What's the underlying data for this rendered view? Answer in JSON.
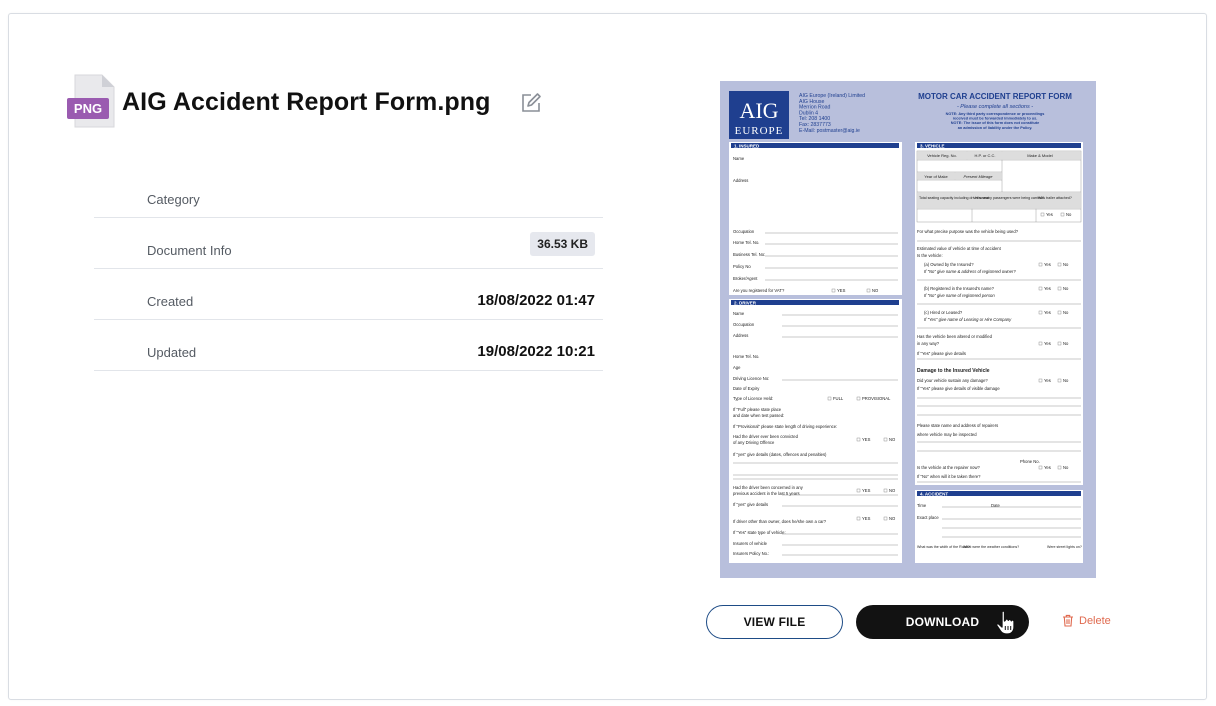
{
  "file": {
    "title": "AIG Accident Report Form.png",
    "type_badge": "PNG"
  },
  "info": [
    {
      "label": "Category",
      "value": ""
    },
    {
      "label": "Document Info",
      "badge": "36.53 KB"
    },
    {
      "label": "Created",
      "value": "18/08/2022 01:47"
    },
    {
      "label": "Updated",
      "value": "19/08/2022 10:21"
    }
  ],
  "preview": {
    "logo_top": "AIG",
    "logo_bottom": "EUROPE",
    "company_lines": [
      "AIG Europe (Ireland) Limited",
      "AIG House",
      "Merrion Road",
      "Dublin 4",
      "Tel: 208 1400",
      "Fax: 2837773",
      "E-Mail: postmaster@aig.ie"
    ],
    "form_title": "MOTOR CAR ACCIDENT REPORT FORM",
    "form_subtitle": "- Please complete all sections -",
    "notes": [
      "NOTE: Any third party correspondence or proceedings",
      "received must be forwarded immediately to us.",
      "NOTE: The issue of this form does not constitute",
      "an admission of liability under the Policy."
    ],
    "sections": {
      "insured": "1. INSURED",
      "driver": "2. DRIVER",
      "vehicle": "3. VEHICLE",
      "accident": "4. ACCIDENT",
      "damage": "Damage to the Insured Vehicle"
    },
    "insured_fields": [
      "Name",
      "Address",
      "Occupation",
      "Home Tel. No.",
      "Business Tel. No:",
      "Policy No",
      "Broker/Agent",
      "Are you registered for VAT?"
    ],
    "driver_fields": [
      "Name",
      "Occupation",
      "Address",
      "Home Tel. No.",
      "Age",
      "Driving Licence No:",
      "Date of Expiry",
      "Type of Licence Held:",
      "If \"Full\" please state place",
      "and date when test passed:",
      "If \"Provisional\" please state length of driving experience:",
      "Had the driver ever been convicted",
      "of any Driving Offence",
      "If \"yes\" give details (dates, offences and penalties)",
      "Had the driver been concerned in any",
      "previous accident in the last 5 years",
      "If \"yes\" give details",
      "If driver other than owner, does he/she own a car?",
      "If \"Yes\" state type of vehicle:",
      "Insurers of vehicle",
      "Insurers Policy No.:"
    ],
    "vehicle_headers": [
      "Vehicle Reg. No.",
      "H.P. or C.C.",
      "Make & Model",
      "Year of Make",
      "Present Mileage",
      "Total seating capacity including driver's seat",
      "How many passengers were being carried?",
      "Was trailer attached?"
    ],
    "vehicle_fields": [
      "For what precise purpose was the vehicle being used?",
      "Estimated value of vehicle at time of accident",
      "Is the vehicle:",
      "(a) Owned by the Insured?",
      "If \"No\" give name & address of registered owner?",
      "(b) Registered in the Insured's name?",
      "If \"No\" give name of registered person",
      "(c) Hired or Leased?",
      "If \"Yes\" give name of Leasing or Hire Company",
      "Has the vehicle been altered or modified",
      "in any way?",
      "If \"Yes\" please give details",
      "Did your vehicle sustain any damage?",
      "If \"Yes\" please give details of visible damage",
      "Please state name and address of repairers",
      "where vehicle may be inspected",
      "Phone No.",
      "Is the vehicle at the repairer now?",
      "If \"No\" when will it be taken there?"
    ],
    "accident_fields": [
      "Time",
      "Date",
      "Exact place",
      "What was the width of the Road?",
      "What were the weather conditions?",
      "Were street lights on?"
    ],
    "yes": "YES",
    "no": "NO",
    "yes_small": "Yes",
    "no_small": "No",
    "full": "FULL",
    "provisional": "PROVISIONAL"
  },
  "actions": {
    "view_label": "VIEW FILE",
    "download_label": "DOWNLOAD",
    "delete_label": "Delete"
  },
  "colors": {
    "preview_bg": "#b8bfdc",
    "aig_blue": "#1f3f8f",
    "section_bar": "#1f3f8f",
    "delete_red": "#e06a4f",
    "view_border": "#1e4c86",
    "badge_bg": "#e6e8ee",
    "png_purple": "#9a5bb0"
  }
}
